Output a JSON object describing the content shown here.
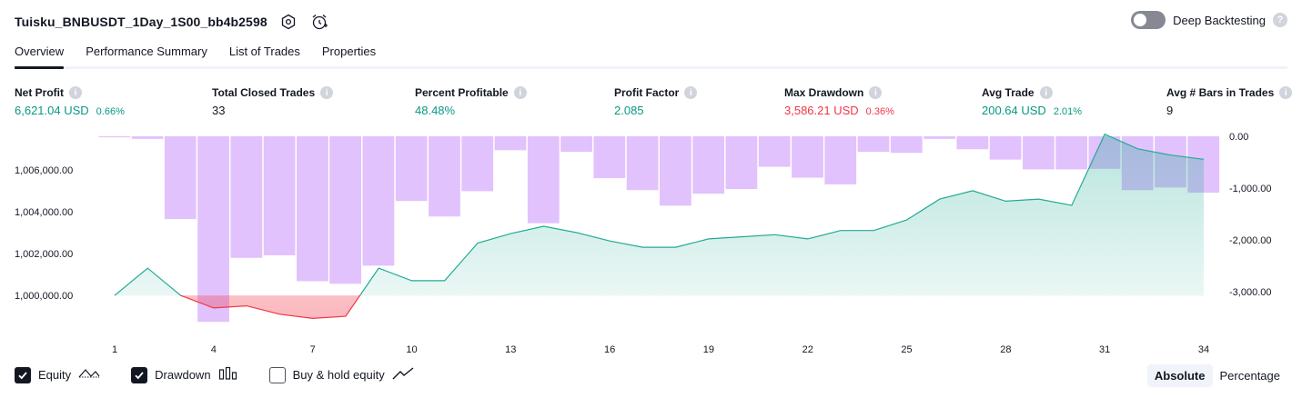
{
  "header": {
    "strategy_name": "Tuisku_BNBUSDT_1Day_1S00_bb4b2598",
    "settings_icon": "settings-icon",
    "alert_icon": "add-alert-icon"
  },
  "deep_backtesting": {
    "label": "Deep Backtesting",
    "enabled": false,
    "help": "?"
  },
  "tabs": [
    {
      "label": "Overview",
      "active": true
    },
    {
      "label": "Performance Summary",
      "active": false
    },
    {
      "label": "List of Trades",
      "active": false
    },
    {
      "label": "Properties",
      "active": false
    }
  ],
  "metrics": [
    {
      "label": "Net Profit",
      "value": "6,621.04 USD",
      "percent": "0.66%",
      "color": "green"
    },
    {
      "label": "Total Closed Trades",
      "value": "33",
      "percent": "",
      "color": "neutral"
    },
    {
      "label": "Percent Profitable",
      "value": "48.48%",
      "percent": "",
      "color": "green"
    },
    {
      "label": "Profit Factor",
      "value": "2.085",
      "percent": "",
      "color": "green"
    },
    {
      "label": "Max Drawdown",
      "value": "3,586.21 USD",
      "percent": "0.36%",
      "color": "red"
    },
    {
      "label": "Avg Trade",
      "value": "200.64 USD",
      "percent": "2.01%",
      "color": "green"
    },
    {
      "label": "Avg # Bars in Trades",
      "value": "9",
      "percent": "",
      "color": "neutral"
    }
  ],
  "info_glyph": "i",
  "chart_data": {
    "type": "line",
    "x_ticks": [
      "1",
      "4",
      "7",
      "10",
      "13",
      "16",
      "19",
      "22",
      "25",
      "28",
      "31",
      "34"
    ],
    "left_axis": {
      "ticks": [
        "1,000,000.00",
        "1,002,000.00",
        "1,004,000.00",
        "1,006,000.00"
      ],
      "range": [
        998700,
        1007600
      ]
    },
    "right_axis": {
      "ticks": [
        "0.00",
        "-1,000.00",
        "-2,000.00",
        "-3,000.00"
      ],
      "range": [
        -3600,
        0
      ]
    },
    "x_range": [
      1,
      34
    ],
    "series": [
      {
        "name": "Equity",
        "x": [
          1,
          2,
          3,
          4,
          5,
          6,
          7,
          8,
          9,
          10,
          11,
          12,
          13,
          14,
          15,
          16,
          17,
          18,
          19,
          20,
          21,
          22,
          23,
          24,
          25,
          26,
          27,
          28,
          29,
          30,
          31,
          32,
          33,
          34
        ],
        "values": [
          1000000,
          1001300,
          1000000,
          999400,
          999500,
          999100,
          998900,
          999000,
          1001300,
          1000700,
          1000700,
          1002500,
          1002950,
          1003300,
          1003000,
          1002600,
          1002300,
          1002300,
          1002700,
          1002800,
          1002900,
          1002700,
          1003100,
          1003100,
          1003600,
          1004600,
          1005000,
          1004500,
          1004600,
          1004300,
          1007700,
          1007000,
          1006700,
          1006500
        ]
      },
      {
        "name": "Drawdown",
        "x": [
          1,
          2,
          3,
          4,
          5,
          6,
          7,
          8,
          9,
          10,
          11,
          12,
          13,
          14,
          15,
          16,
          17,
          18,
          19,
          20,
          21,
          22,
          23,
          24,
          25,
          26,
          27,
          28,
          29,
          30,
          31,
          32,
          33,
          34
        ],
        "values": [
          -20,
          -50,
          -1600,
          -3586,
          -2350,
          -2300,
          -2800,
          -2850,
          -2500,
          -1250,
          -1550,
          -1060,
          -270,
          -1680,
          -300,
          -810,
          -1040,
          -1340,
          -1110,
          -1020,
          -590,
          -800,
          -930,
          -300,
          -320,
          -50,
          -250,
          -450,
          -640,
          -640,
          -630,
          -1040,
          -990,
          -1090
        ]
      }
    ]
  },
  "legend": [
    {
      "label": "Equity",
      "checked": true,
      "icon": "equity-line-icon"
    },
    {
      "label": "Drawdown",
      "checked": true,
      "icon": "drawdown-bars-icon"
    },
    {
      "label": "Buy & hold equity",
      "checked": false,
      "icon": "buy-hold-line-icon"
    }
  ],
  "modes": [
    {
      "label": "Absolute",
      "active": true
    },
    {
      "label": "Percentage",
      "active": false
    }
  ],
  "colors": {
    "equity_pos_line": "#22ab94",
    "equity_neg_line": "#f23645",
    "drawdown_bar": "#e1c2fd",
    "green_text": "#089981",
    "red_text": "#f23645"
  }
}
